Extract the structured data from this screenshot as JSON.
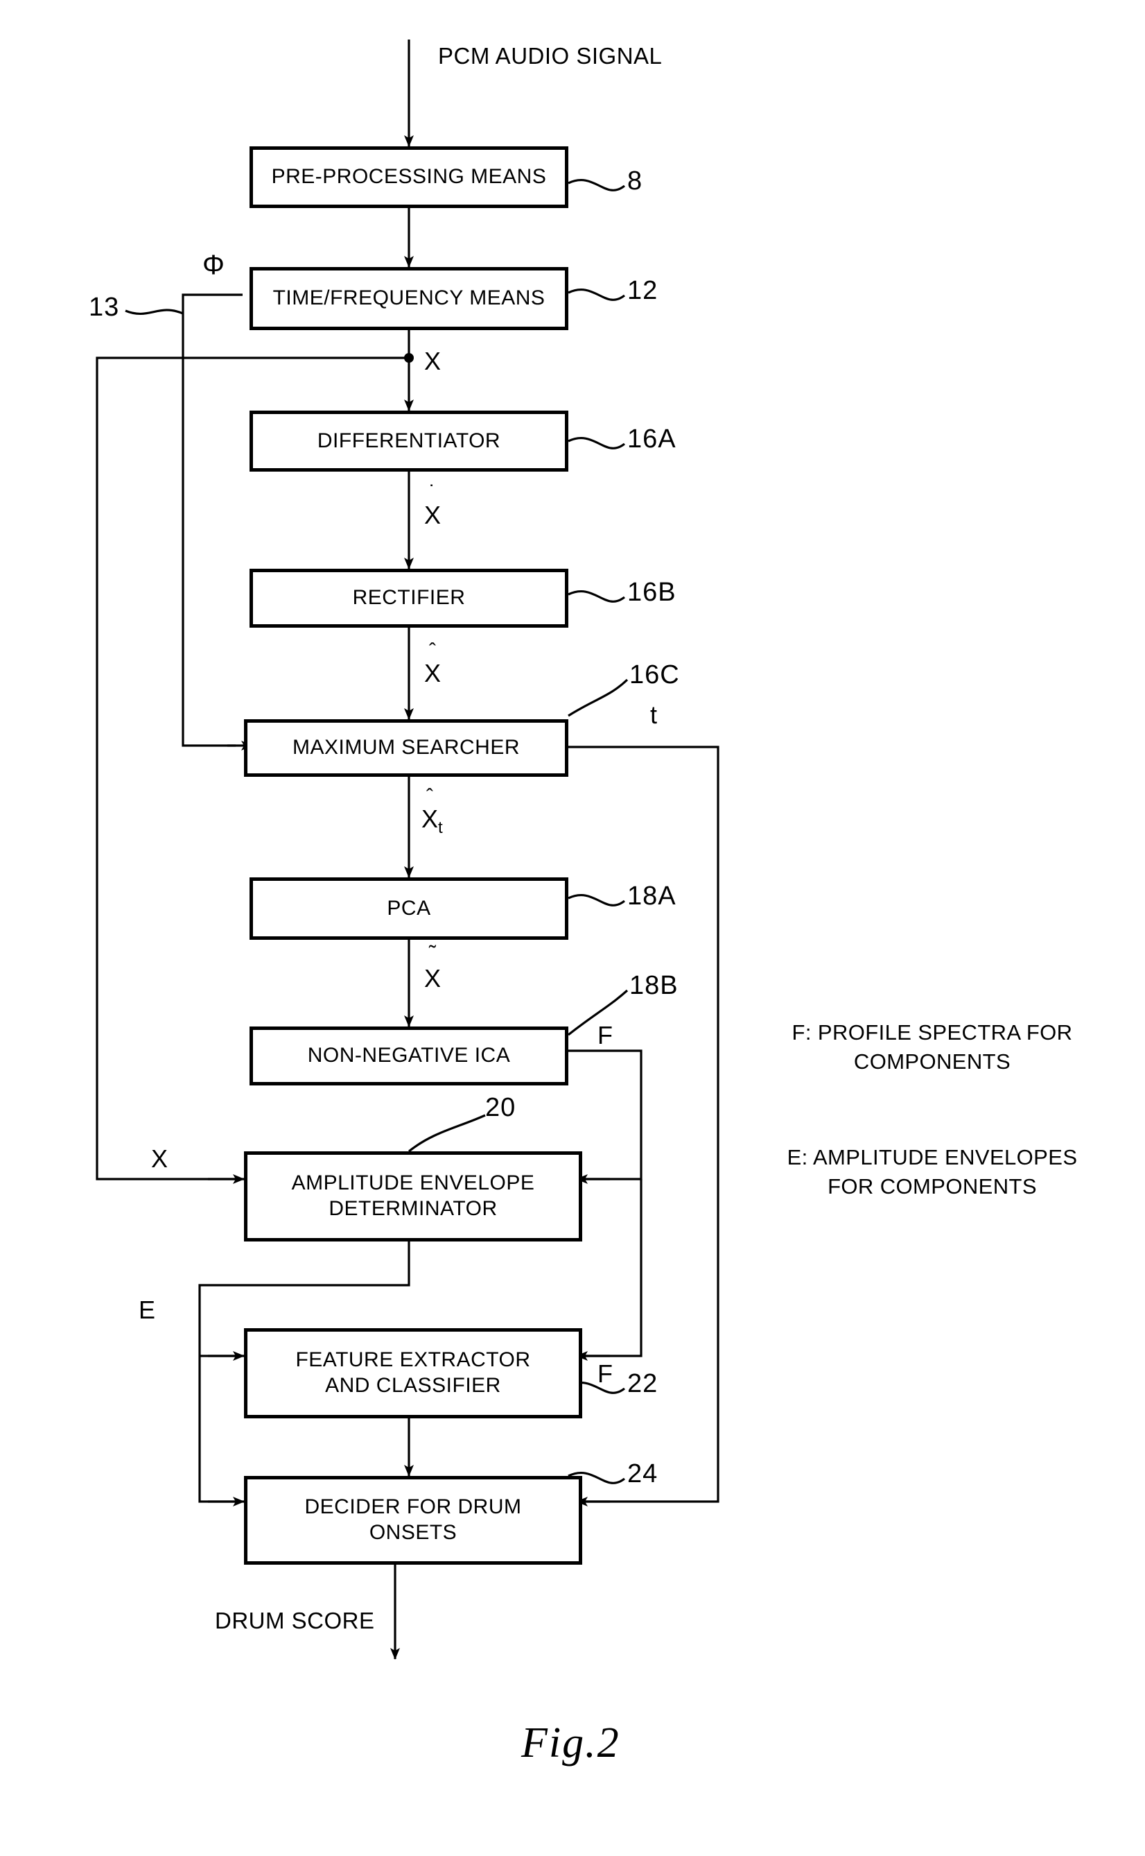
{
  "figure": {
    "caption": "Fig.2",
    "input_label": "PCM AUDIO SIGNAL",
    "output_label": "DRUM SCORE"
  },
  "blocks": [
    {
      "id": "pre-processing-means",
      "label": "PRE-PROCESSING MEANS",
      "ref": "8"
    },
    {
      "id": "time-frequency-means",
      "label": "TIME/FREQUENCY MEANS",
      "ref": "12"
    },
    {
      "id": "differentiator",
      "label": "DIFFERENTIATOR",
      "ref": "16A"
    },
    {
      "id": "rectifier",
      "label": "RECTIFIER",
      "ref": "16B"
    },
    {
      "id": "maximum-searcher",
      "label": "MAXIMUM SEARCHER",
      "ref": "16C"
    },
    {
      "id": "pca",
      "label": "PCA",
      "ref": "18A"
    },
    {
      "id": "non-negative-ica",
      "label": "NON-NEGATIVE ICA",
      "ref": "18B"
    },
    {
      "id": "amplitude-envelope-determinator",
      "label": "AMPLITUDE ENVELOPE\nDETERMINATOR",
      "ref": "20"
    },
    {
      "id": "feature-extractor-and-classifier",
      "label": "FEATURE EXTRACTOR\nAND CLASSIFIER",
      "ref": "22"
    },
    {
      "id": "decider-for-drum-onsets",
      "label": "DECIDER FOR DRUM\nONSETS",
      "ref": "24"
    }
  ],
  "signals": {
    "phi": "Φ",
    "feedback_ref": "13",
    "x": "X",
    "x_dot": "X",
    "x_hat": "X",
    "x_hat_t": "X",
    "x_hat_t_sub": "t",
    "x_tilde": "X",
    "t": "t",
    "f": "F",
    "e": "E",
    "x_env_input": "X",
    "dot_mark": "˙",
    "hat_mark": "ˆ",
    "tilde_mark": "˜"
  },
  "legend": [
    {
      "id": "legend-f",
      "text": "F: PROFILE SPECTRA FOR\nCOMPONENTS"
    },
    {
      "id": "legend-e",
      "text": "E: AMPLITUDE ENVELOPES\nFOR COMPONENTS"
    }
  ],
  "colors": {
    "ink": "#000000",
    "paper": "#ffffff"
  }
}
